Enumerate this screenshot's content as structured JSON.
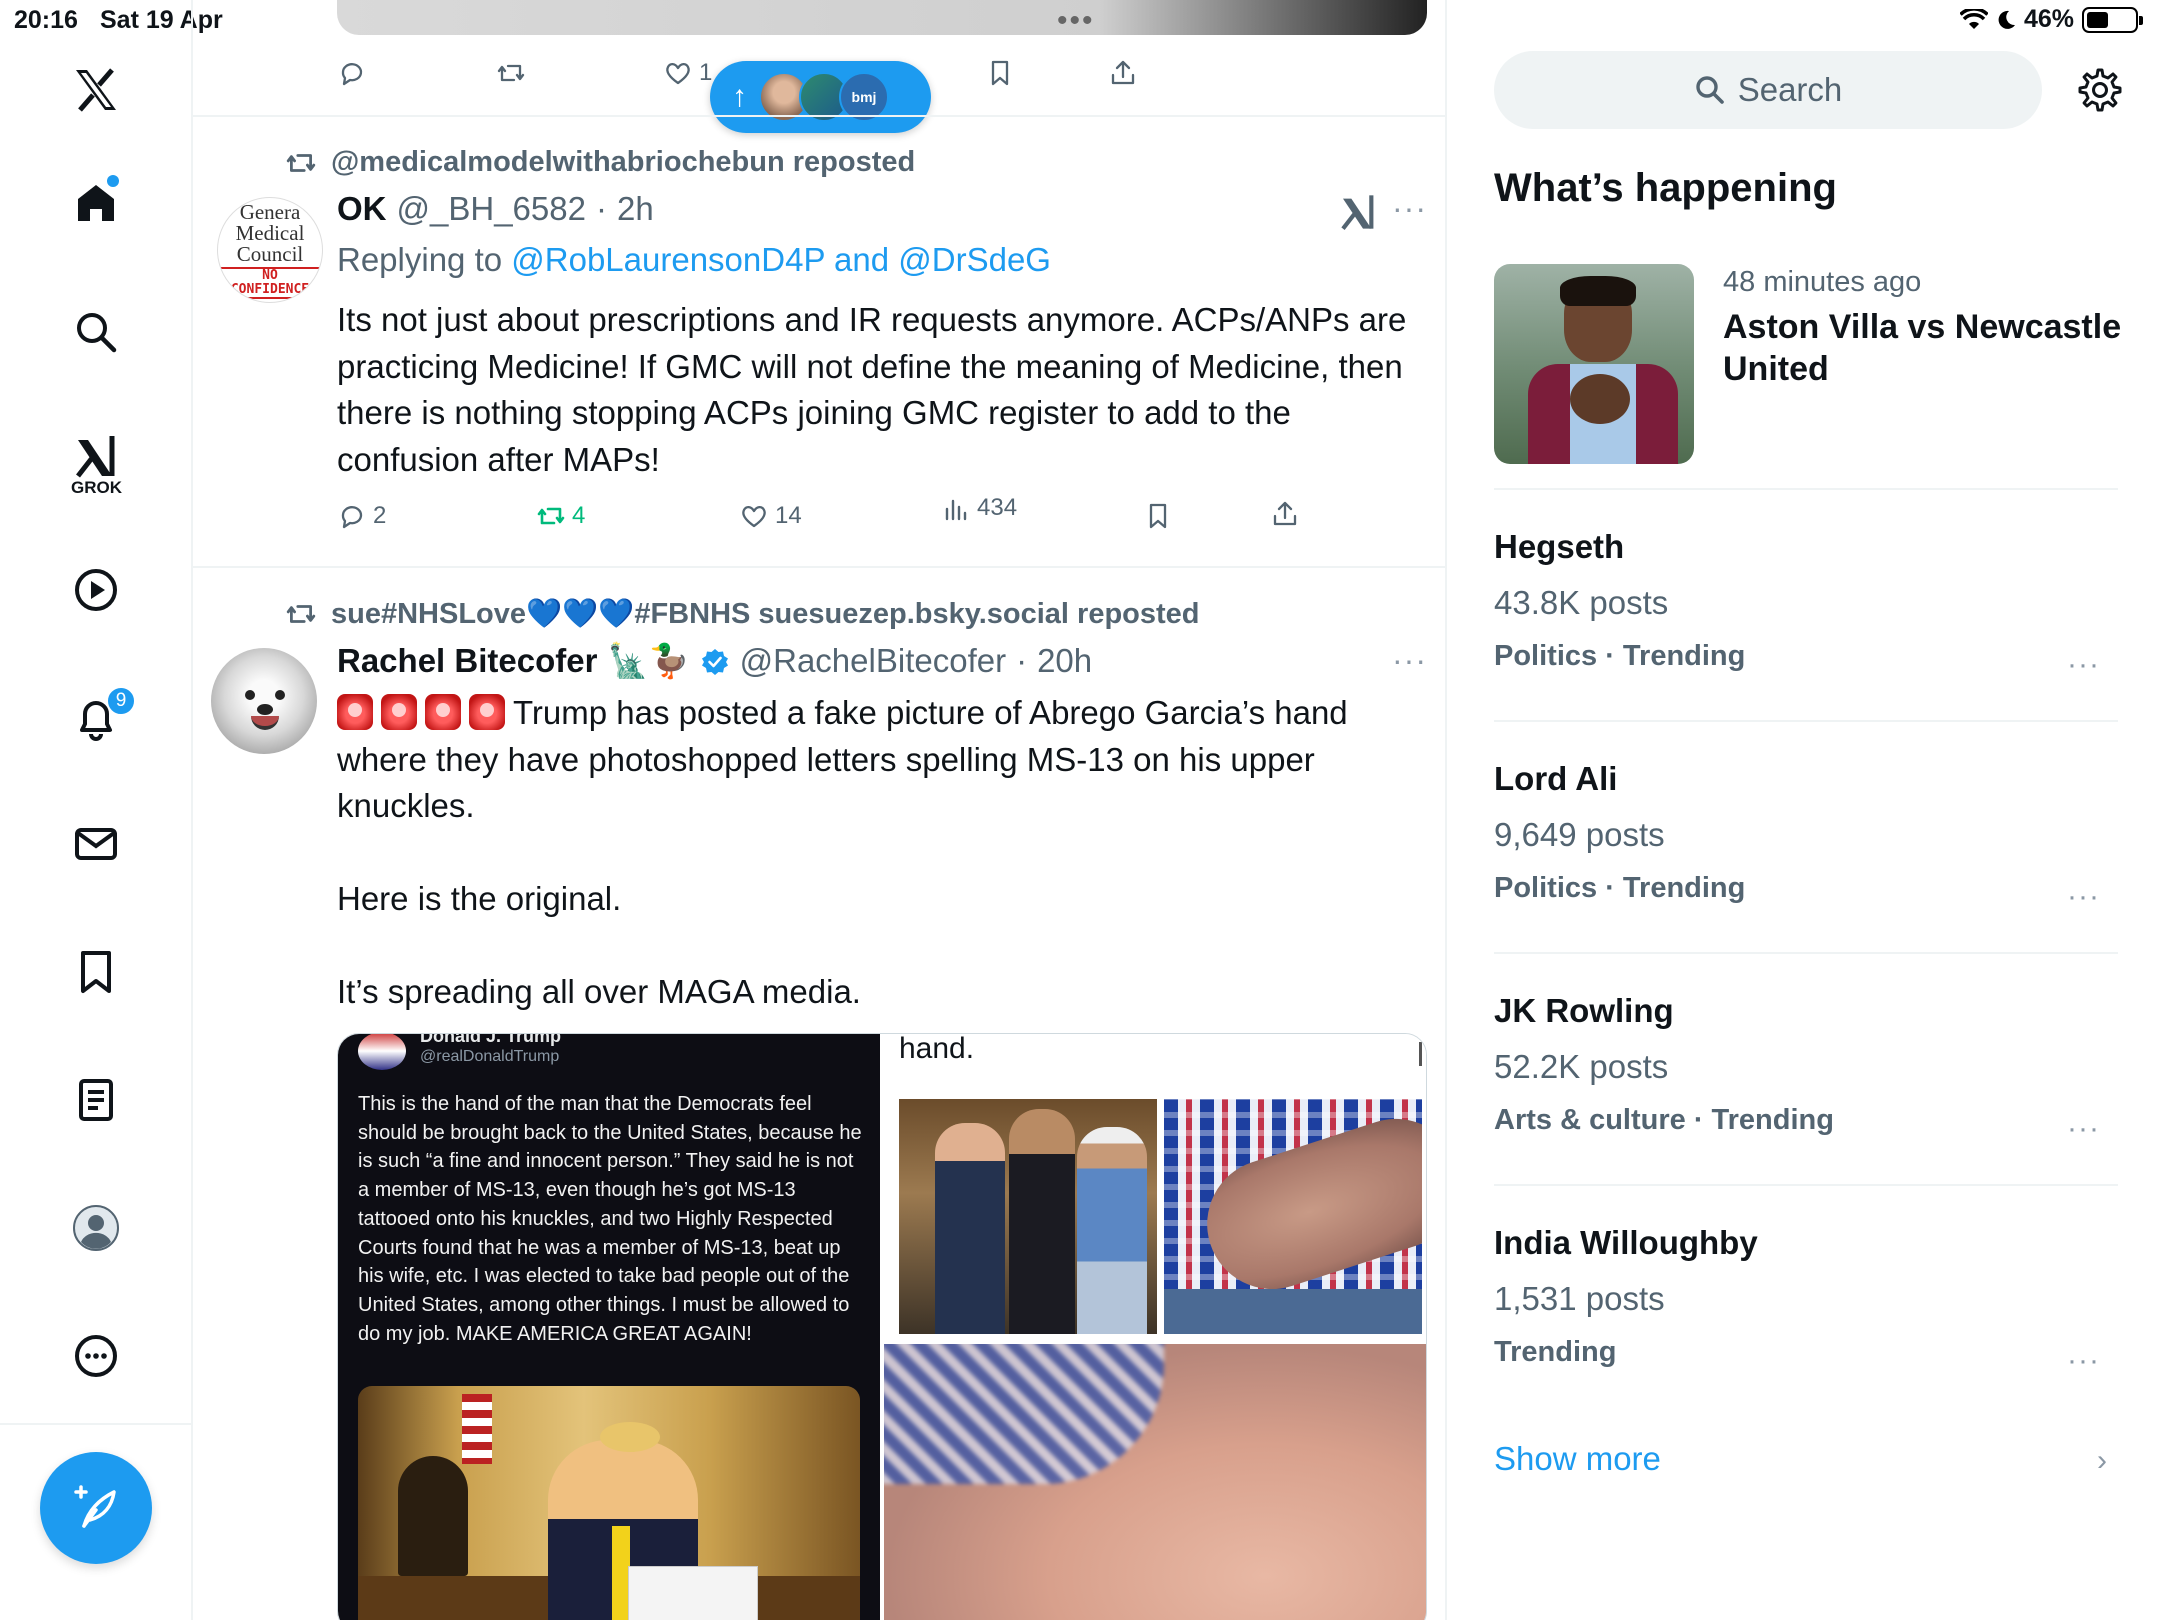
{
  "status_bar": {
    "time": "20:16",
    "date": "Sat 19 Apr",
    "battery": "46%",
    "battery_level": 0.46
  },
  "nav": {
    "grok_label": "GROK",
    "notification_count": "9",
    "items": [
      "x-logo-icon",
      "home-icon",
      "search-icon",
      "grok-icon",
      "video-icon",
      "bell-icon",
      "mail-icon",
      "bookmark-icon",
      "list-icon",
      "profile-icon",
      "more-icon"
    ]
  },
  "feed": {
    "top_post_actions": {
      "likes": "1"
    },
    "new_posts_pill": {
      "arrow": "↑",
      "avatar3_text": "bmj"
    },
    "post1": {
      "repost_by": "@medicalmodelwithabriochebun reposted",
      "name": "OK",
      "handle": "@_BH_6582",
      "time": "2h",
      "avatar_lines": [
        "Genera",
        "Medical",
        "Council"
      ],
      "avatar_stamp": "NO CONFIDENCE",
      "replying_prefix": "Replying to ",
      "replying_to": "@RobLaurensonD4P and @DrSdeG",
      "text": "Its not just about prescriptions and IR requests anymore. ACPs/ANPs are practicing Medicine! If GMC will not define the meaning of Medicine, then there is nothing stopping ACPs joining GMC register to add to the confusion after MAPs!",
      "replies": "2",
      "reposts": "4",
      "likes": "14",
      "views": "434"
    },
    "post2": {
      "repost_by": "sue#NHSLove💙💙💙#FBNHS suesuezep.bsky.social reposted",
      "name": "Rachel Bitecofer",
      "name_emoji": "🗽🦆",
      "handle": "@RachelBitecofer",
      "time": "20h",
      "text_line1": "Trump has posted a fake picture of Abrego Garcia’s hand where they have photoshopped letters spelling MS-13 on his upper knuckles.",
      "text_line2": "Here is the original.",
      "text_line3": "It’s spreading all over MAGA media.",
      "media": {
        "left_author": "Donald J. Trump",
        "left_handle": "@realDonaldTrump",
        "left_text": "This is the hand of the man that the Democrats feel should be brought back to the United States, because he is such “a fine and innocent person.” They said he is not a member of MS-13, even though he’s got MS-13 tattooed onto his knuckles, and two Highly Respected Courts found that he was a member of MS-13, beat up his wife, etc. I was elected to take bad people out of the United States, among other things. I must be allowed to do my job. MAKE AMERICA GREAT AGAIN!",
        "right_caption": "hand."
      }
    }
  },
  "sidebar": {
    "search_placeholder": "Search",
    "whats_happening": "What’s happening",
    "featured": {
      "time": "48 minutes ago",
      "title": "Aston Villa vs Newcastle United"
    },
    "trends": [
      {
        "name": "Hegseth",
        "posts": "43.8K posts",
        "category": "Politics · Trending"
      },
      {
        "name": "Lord Ali",
        "posts": "9,649 posts",
        "category": "Politics · Trending"
      },
      {
        "name": "JK Rowling",
        "posts": "52.2K posts",
        "category": "Arts & culture · Trending"
      },
      {
        "name": "India Willoughby",
        "posts": "1,531 posts",
        "category": "Trending"
      }
    ],
    "show_more": "Show more",
    "more_dots": "···"
  }
}
